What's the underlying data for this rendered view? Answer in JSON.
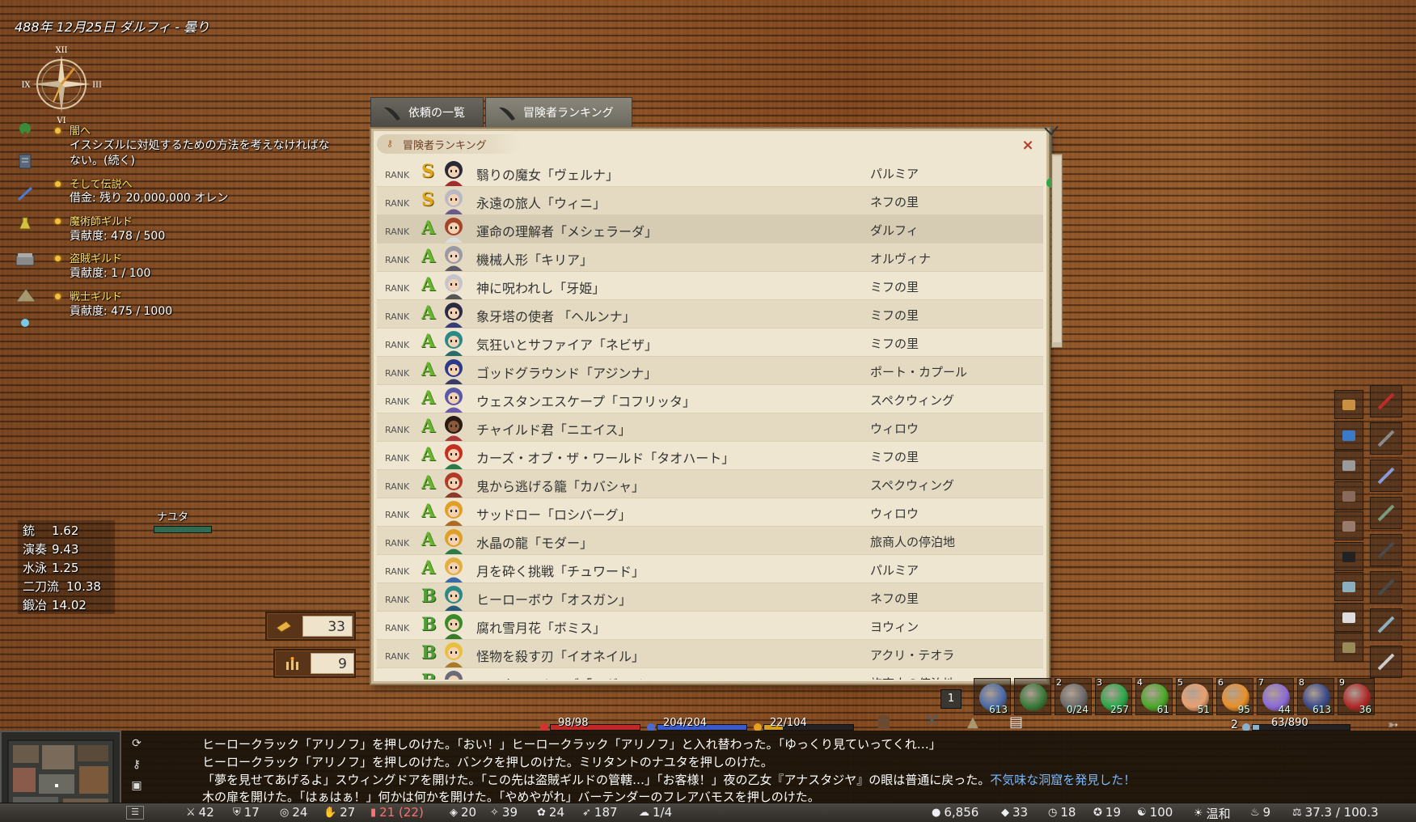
{
  "header": {
    "date": "488年 12月25日 ダルフィ - 曇り",
    "compass": {
      "top": "XII",
      "left": "IX",
      "right": "III",
      "bottom": "VI"
    }
  },
  "quests": [
    {
      "title": "闇へ",
      "lines": [
        "イスシズルに対処するための方法を考えなければな",
        "ない。(続く)"
      ],
      "icon": "tree-icon"
    },
    {
      "title": "そして伝説へ",
      "lines": [
        "借金: 残り 20,000,000 オレン"
      ],
      "icon": "scroll-icon"
    },
    {
      "title": "魔術師ギルド",
      "lines": [
        "貢献度: 478 / 500"
      ],
      "icon": "potion-icon"
    },
    {
      "title": "盗賊ギルド",
      "lines": [
        "貢献度: 1 / 100"
      ],
      "icon": "chest-icon"
    },
    {
      "title": "戦士ギルド",
      "lines": [
        "貢献度: 475 / 1000"
      ],
      "icon": "tent-icon"
    }
  ],
  "skills": [
    {
      "name": "銃",
      "value": "1.62"
    },
    {
      "name": "演奏",
      "value": "9.43"
    },
    {
      "name": "水泳",
      "value": "1.25"
    },
    {
      "name": "二刀流",
      "value": "10.38"
    },
    {
      "name": "鍛冶",
      "value": "14.02"
    }
  ],
  "ally": {
    "name": "ナユタ",
    "hp_fraction": 1.0
  },
  "counters": [
    {
      "icon": "ticket-icon",
      "value": "33"
    },
    {
      "icon": "candle-icon",
      "value": "9"
    }
  ],
  "tabs": [
    {
      "label": "依頼の一覧",
      "active": false
    },
    {
      "label": "冒険者ランキング",
      "active": true
    }
  ],
  "panel": {
    "title": "冒険者ランキング",
    "close": "×",
    "rank_label": "RANK",
    "rows": [
      {
        "grade": "S",
        "name": "翳りの魔女「ヴェルナ」",
        "place": "パルミア",
        "hair": "#2a2a35",
        "skin": "#f3d2b4",
        "cloth": "#a02c2c"
      },
      {
        "grade": "S",
        "name": "永遠の旅人「ウィニ」",
        "place": "ネフの里",
        "hair": "#b9b9c6",
        "skin": "#f3d2b4",
        "cloth": "#6a5c8a"
      },
      {
        "grade": "A",
        "name": "運命の理解者「メシェラーダ」",
        "place": "ダルフィ",
        "hair": "#a4452a",
        "skin": "#f3d2b4",
        "cloth": "#ddd"
      },
      {
        "grade": "A",
        "name": "機械人形「キリア」",
        "place": "オルヴィナ",
        "hair": "#9a9aa4",
        "skin": "#f0d6c0",
        "cloth": "#5a5a66"
      },
      {
        "grade": "A",
        "name": "神に呪われし「牙姫」",
        "place": "ミフの里",
        "hair": "#c4c4cc",
        "skin": "#f3d2b4",
        "cloth": "#555"
      },
      {
        "grade": "A",
        "name": "象牙塔の使者 「ヘルンナ」",
        "place": "ミフの里",
        "hair": "#2a2a44",
        "skin": "#f3d2b4",
        "cloth": "#3a3a78"
      },
      {
        "grade": "A",
        "name": "気狂いとサファイア「ネビザ」",
        "place": "ミフの里",
        "hair": "#2b8a86",
        "skin": "#f3d2b4",
        "cloth": "#2a6a6a"
      },
      {
        "grade": "A",
        "name": "ゴッドグラウンド「アジンナ」",
        "place": "ポート・カプール",
        "hair": "#2c3c8a",
        "skin": "#f3d2b4",
        "cloth": "#3a3a6a"
      },
      {
        "grade": "A",
        "name": "ウェスタンエスケープ「コフリッタ」",
        "place": "スペクウィング",
        "hair": "#5a5aa8",
        "skin": "#f3d2b4",
        "cloth": "#6a5aa8"
      },
      {
        "grade": "A",
        "name": "チャイルド君「ニエイス」",
        "place": "ウィロウ",
        "hair": "#2a1a12",
        "skin": "#8a5a3a",
        "cloth": "#aa3a3a"
      },
      {
        "grade": "A",
        "name": "カーズ・オブ・ザ・ワールド「タオハート」",
        "place": "ミフの里",
        "hair": "#c43020",
        "skin": "#f3d2b4",
        "cloth": "#2a7a4a"
      },
      {
        "grade": "A",
        "name": "鬼から逃げる籠「カバシャ」",
        "place": "スペクウィング",
        "hair": "#b03a28",
        "skin": "#f3d2b4",
        "cloth": "#8a3a2a"
      },
      {
        "grade": "A",
        "name": "サッドロー「ロシバーグ」",
        "place": "ウィロウ",
        "hair": "#e0a028",
        "skin": "#f3d2b4",
        "cloth": "#b06a28"
      },
      {
        "grade": "A",
        "name": "水晶の龍「モダー」",
        "place": "旅商人の停泊地",
        "hair": "#e0a028",
        "skin": "#f3d2b4",
        "cloth": "#2a7a4a"
      },
      {
        "grade": "A",
        "name": "月を砕く挑戦「チュワード」",
        "place": "パルミア",
        "hair": "#e2b040",
        "skin": "#f3d2b4",
        "cloth": "#3a6aa8"
      },
      {
        "grade": "B",
        "name": "ヒーローボウ「オスガン」",
        "place": "ネフの里",
        "hair": "#2b8a86",
        "skin": "#f3d2b4",
        "cloth": "#2a5a7a"
      },
      {
        "grade": "B",
        "name": "腐れ雪月花「ボミス」",
        "place": "ヨウィン",
        "hair": "#3a8a2a",
        "skin": "#f3d2b4",
        "cloth": "#3a7a2a"
      },
      {
        "grade": "B",
        "name": "怪物を殺す刃「イオネイル」",
        "place": "アクリ・テオラ",
        "hair": "#e8c040",
        "skin": "#f3d2b4",
        "cloth": "#a87a2a"
      },
      {
        "grade": "B",
        "name": "ユスター・キーブ「ログルイン」",
        "place": "旅商人の停泊地",
        "hair": "#6a6a78",
        "skin": "#f3d2b4",
        "cloth": "#5a5a66"
      }
    ]
  },
  "hotbar": {
    "left_badge": "1",
    "slots": [
      {
        "num": "",
        "count": "613",
        "color": "#4a6aa8"
      },
      {
        "num": "",
        "count": "",
        "color": "#3a7a3a"
      },
      {
        "num": "2",
        "count": "0/24",
        "color": "#6a6a6a"
      },
      {
        "num": "3",
        "count": "257",
        "color": "#2aa84a"
      },
      {
        "num": "4",
        "count": "61",
        "color": "#4aa82a"
      },
      {
        "num": "5",
        "count": "51",
        "color": "#e8a070"
      },
      {
        "num": "6",
        "count": "95",
        "color": "#e8902a"
      },
      {
        "num": "7",
        "count": "44",
        "color": "#8a6ad8"
      },
      {
        "num": "8",
        "count": "613",
        "color": "#3a4a8a"
      },
      {
        "num": "9",
        "count": "36",
        "color": "#b02a2a"
      }
    ]
  },
  "bars": {
    "hp": {
      "text": "98/98",
      "fraction": 1.0,
      "color": "#c02828"
    },
    "mp": {
      "text": "204/204",
      "fraction": 1.0,
      "color": "#3a5ac8"
    },
    "sp": {
      "text": "22/104",
      "fraction": 0.21,
      "color": "#d8a020"
    },
    "weight_level": "2",
    "weight": {
      "text": "63/890",
      "fraction": 0.07,
      "color": "#8ab0d0"
    }
  },
  "log": {
    "lines": [
      "ヒーロークラック「アリノフ」を押しのけた。「おい！」ヒーロークラック「アリノフ」と入れ替わった。「ゆっくり見ていってくれ…」",
      "ヒーロークラック「アリノフ」を押しのけた。バンクを押しのけた。ミリタントのナユタを押しのけた。",
      "「夢を見せてあげるよ」スウィングドアを開けた。「この先は盗賊ギルドの管轄…」「お客様！」夜の乙女『アナスタジヤ』の眼は普通に戻った。",
      "木の扉を開けた。「はぁはぁ！」何かは何かを開けた。「やめやがれ」バーテンダーのフレアバモスを押しのけた。"
    ],
    "highlight": "不気味な洞窟を発見した！"
  },
  "status": {
    "left": [
      {
        "icon": "sword-icon",
        "value": "42"
      },
      {
        "icon": "armor-icon",
        "value": "17"
      },
      {
        "icon": "shield-icon",
        "value": "24"
      },
      {
        "icon": "dex-icon",
        "value": "27"
      },
      {
        "icon": "book-icon",
        "value": "21 (22)",
        "color": "#ff7070"
      },
      {
        "icon": "wil-icon",
        "value": "20"
      },
      {
        "icon": "mag-icon",
        "value": "39"
      },
      {
        "icon": "cha-icon",
        "value": "24"
      },
      {
        "icon": "spd-icon",
        "value": "187"
      },
      {
        "icon": "life-icon",
        "value": "1/4"
      }
    ],
    "right": [
      {
        "icon": "gold-icon",
        "value": "6,856"
      },
      {
        "icon": "platinum-icon",
        "value": "33"
      },
      {
        "icon": "time-icon",
        "value": "18"
      },
      {
        "icon": "fame-icon",
        "value": "19"
      },
      {
        "icon": "karma-icon",
        "value": "100"
      },
      {
        "icon": "weather-icon",
        "value": "温和"
      },
      {
        "icon": "hunger-icon",
        "value": "9"
      },
      {
        "icon": "weight-icon",
        "value": "37.3 / 100.3"
      }
    ]
  },
  "colors": {
    "panel_bg": "#efe6d1",
    "accent_gold": "#ffe060",
    "log_highlight": "#7ab8ff"
  }
}
